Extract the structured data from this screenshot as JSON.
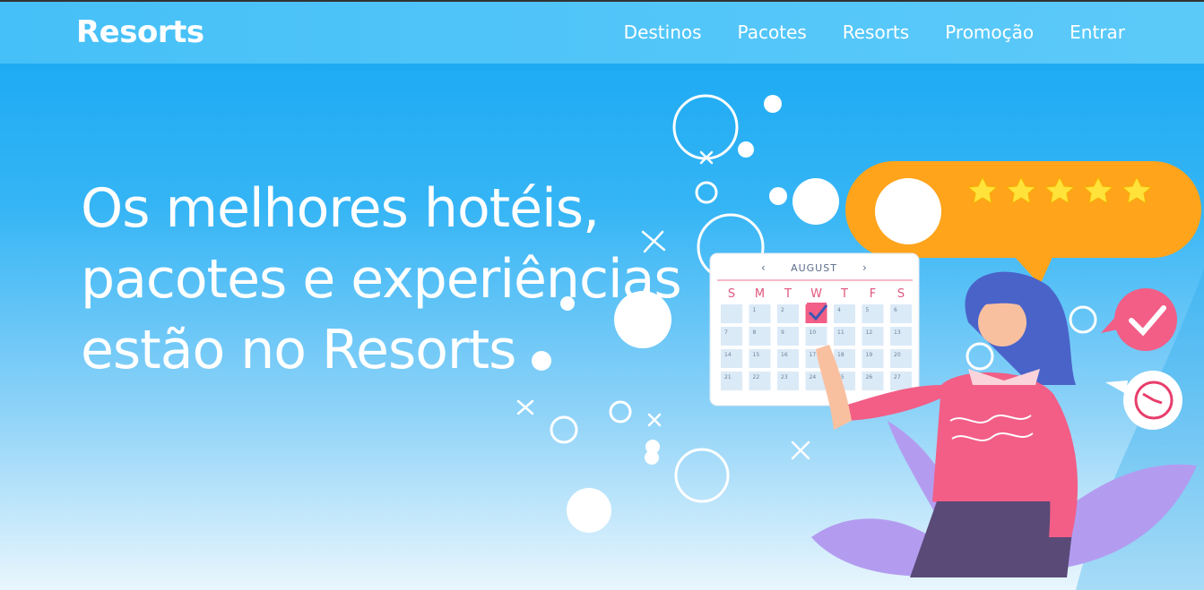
{
  "header": {
    "logo": "Resorts",
    "nav": [
      {
        "label": "Destinos"
      },
      {
        "label": "Pacotes"
      },
      {
        "label": "Resorts"
      },
      {
        "label": "Promoção"
      },
      {
        "label": "Entrar"
      }
    ]
  },
  "hero": {
    "title_lines": [
      "Os melhores hotéis,",
      "pacotes e experiências",
      "estão no Resorts"
    ]
  },
  "illustration": {
    "calendar": {
      "month": "AUGUST",
      "weekdays": [
        "S",
        "M",
        "T",
        "W",
        "T",
        "F",
        "S"
      ],
      "selected_day": 3,
      "days": [
        [
          "",
          "1",
          "2",
          "3",
          "4",
          "5",
          "6"
        ],
        [
          "7",
          "8",
          "9",
          "10",
          "11",
          "12",
          "13"
        ],
        [
          "14",
          "15",
          "16",
          "17",
          "18",
          "19",
          "20"
        ],
        [
          "21",
          "22",
          "23",
          "24",
          "25",
          "26",
          "27"
        ]
      ]
    },
    "rating_stars": 5
  },
  "colors": {
    "accent_orange": "#ffa41b",
    "pink": "#f76a8c",
    "purple": "#9d84e8",
    "hero_blue": "#14a6f3"
  }
}
